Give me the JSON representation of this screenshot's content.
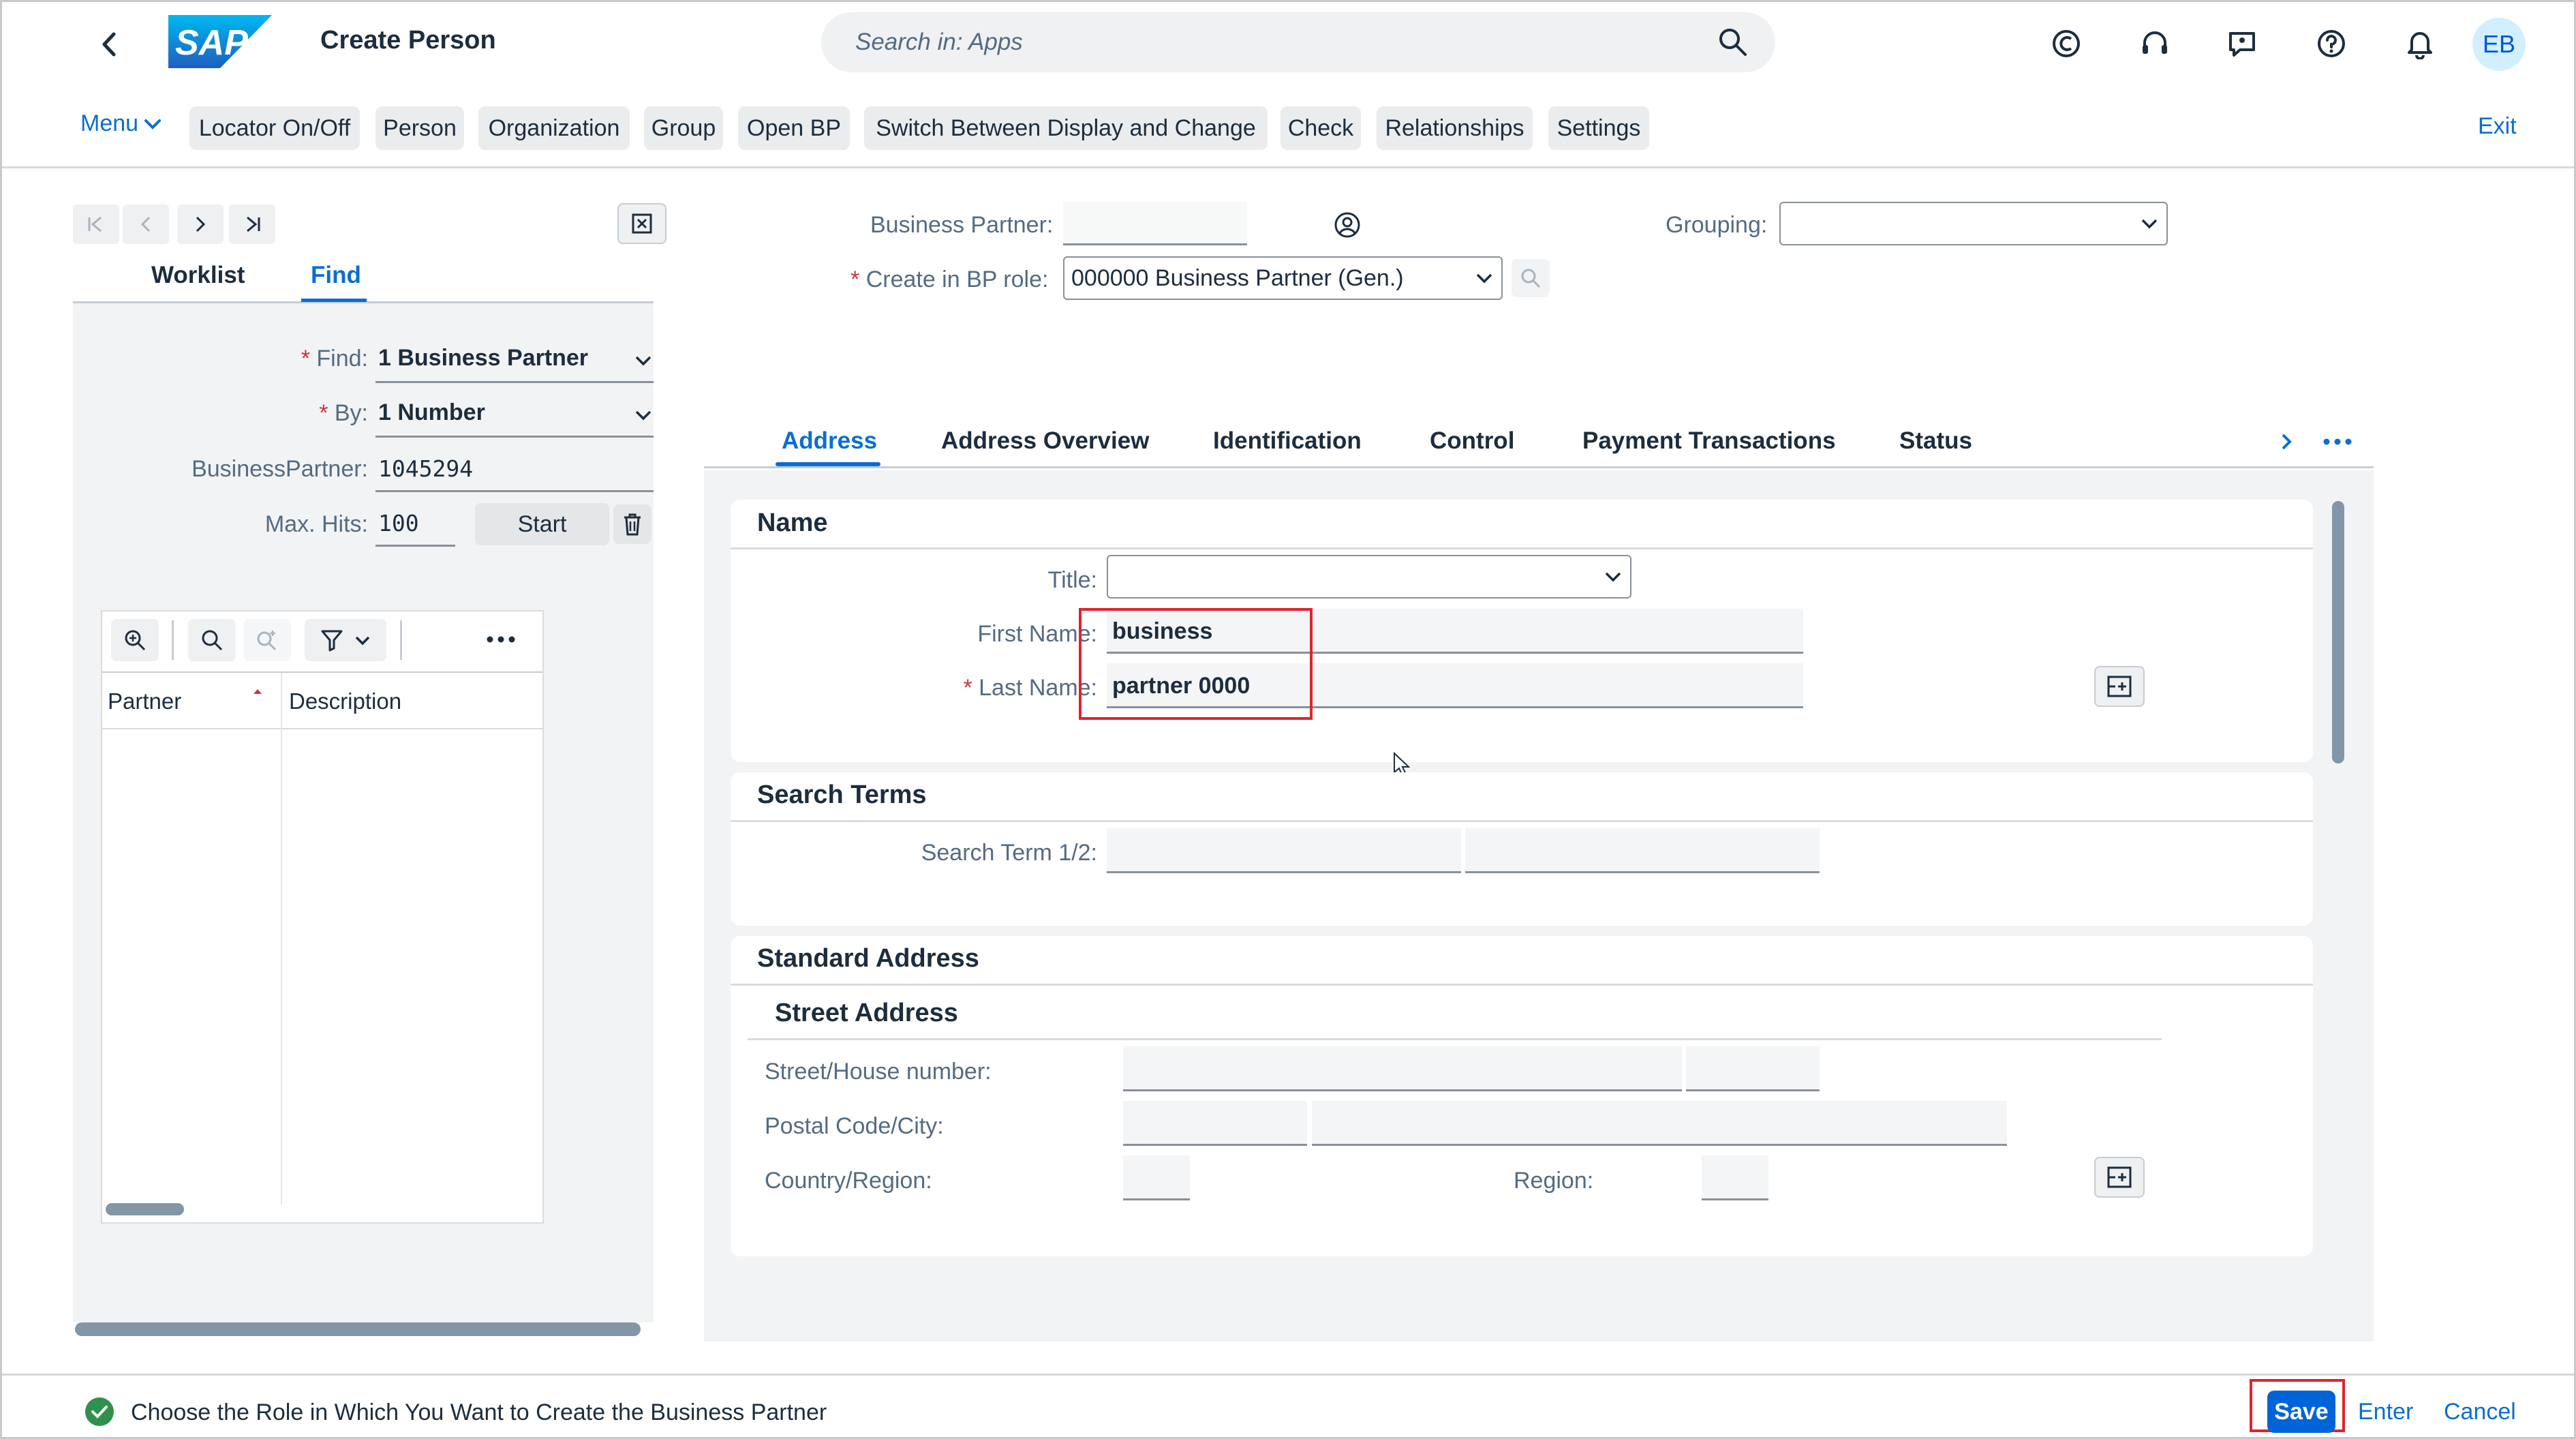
{
  "shell": {
    "title": "Create Person",
    "search_placeholder": "Search in: Apps",
    "avatar_initials": "EB",
    "logo_text": "SAP"
  },
  "toolbar": {
    "menu_label": "Menu",
    "buttons": [
      "Locator On/Off",
      "Person",
      "Organization",
      "Group",
      "Open BP",
      "Switch Between Display and Change",
      "Check",
      "Relationships",
      "Settings"
    ],
    "exit_label": "Exit"
  },
  "left_pane": {
    "tabs": [
      "Worklist",
      "Find"
    ],
    "active_tab": "Find",
    "find_label": "Find:",
    "find_value": "1 Business Partner",
    "by_label": "By:",
    "by_value": "1 Number",
    "bp_label": "BusinessPartner:",
    "bp_value": "1045294",
    "maxhits_label": "Max. Hits:",
    "maxhits_value": "100",
    "start_label": "Start",
    "grid_columns": [
      "Partner",
      "Description"
    ]
  },
  "header": {
    "bp_label": "Business Partner:",
    "bp_value": "",
    "grouping_label": "Grouping:",
    "grouping_value": "",
    "role_label": "Create in BP role:",
    "role_value": "000000 Business Partner (Gen.)"
  },
  "tabs": [
    "Address",
    "Address Overview",
    "Identification",
    "Control",
    "Payment Transactions",
    "Status"
  ],
  "active_tab": "Address",
  "name_section": {
    "title": "Name",
    "title_label": "Title:",
    "title_value": "",
    "first_name_label": "First Name:",
    "first_name_value": "business",
    "last_name_label": "Last Name:",
    "last_name_value": "partner 0000"
  },
  "search_terms": {
    "title": "Search Terms",
    "label": "Search Term 1/2:"
  },
  "standard_address": {
    "title": "Standard Address",
    "subtitle": "Street Address",
    "street_label": "Street/House number:",
    "postal_label": "Postal Code/City:",
    "country_label": "Country/Region:",
    "region_label": "Region:"
  },
  "footer": {
    "status_message": "Choose the Role in Which You Want to Create the Business Partner",
    "save_label": "Save",
    "enter_label": "Enter",
    "cancel_label": "Cancel"
  },
  "colors": {
    "accent": "#0a6ed1",
    "save_bg": "#0064d9",
    "highlight": "#e1232d",
    "success": "#30914c"
  }
}
